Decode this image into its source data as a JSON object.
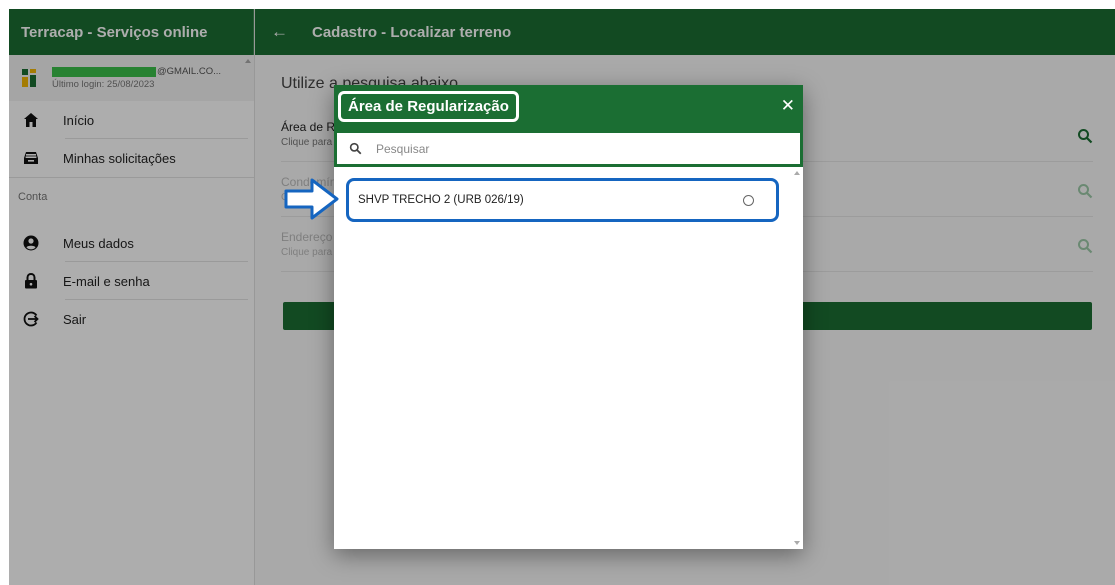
{
  "colors": {
    "brand_green": "#1b6e33",
    "highlight_blue": "#1565c0",
    "mask_green": "#3cc04a"
  },
  "sidebar": {
    "app_title": "Terracap - Serviços online",
    "user": {
      "email_suffix": "@GMAIL.CO...",
      "last_login": "Último login: 25/08/2023"
    },
    "items": [
      {
        "label": "Início",
        "icon": "home-icon"
      },
      {
        "label": "Minhas solicitações",
        "icon": "inbox-icon"
      }
    ],
    "section_label": "Conta",
    "account_items": [
      {
        "label": "Meus dados",
        "icon": "account-circle-icon"
      },
      {
        "label": "E-mail e senha",
        "icon": "lock-icon"
      },
      {
        "label": "Sair",
        "icon": "logout-icon"
      }
    ]
  },
  "header": {
    "back_icon": "arrow-left-icon",
    "title": "Cadastro - Localizar terreno"
  },
  "main": {
    "intro": "Utilize a pesquisa abaixo",
    "fields": [
      {
        "label": "Área de Regularização",
        "hint": "Clique para selecionar"
      },
      {
        "label": "Condomínio",
        "hint": "Clique para selecionar"
      },
      {
        "label": "Endereço",
        "hint": "Clique para selecionar"
      }
    ]
  },
  "modal": {
    "title": "Área de Regularização",
    "close": "✕",
    "search_placeholder": "Pesquisar",
    "options": [
      {
        "label": "SHVP TRECHO 2 (URB 026/19)",
        "selected": false
      }
    ]
  }
}
